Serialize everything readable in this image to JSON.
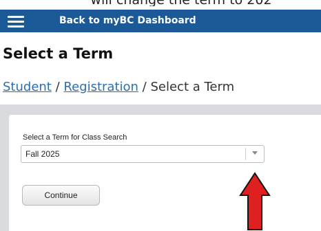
{
  "caption": {
    "text": "will change the term to 202"
  },
  "header": {
    "back_link": "Back to myBC Dashboard"
  },
  "page": {
    "title": "Select a Term"
  },
  "breadcrumb": {
    "items": [
      "Student",
      "Registration",
      "Select a Term"
    ],
    "separator": "/"
  },
  "form": {
    "label": "Select a Term for Class Search",
    "select_value": "Fall 2025",
    "continue_label": "Continue"
  },
  "colors": {
    "header_bg": "#1b5a96",
    "link": "#2c6fb0",
    "arrow_fill": "#e02020",
    "arrow_stroke": "#111111"
  }
}
